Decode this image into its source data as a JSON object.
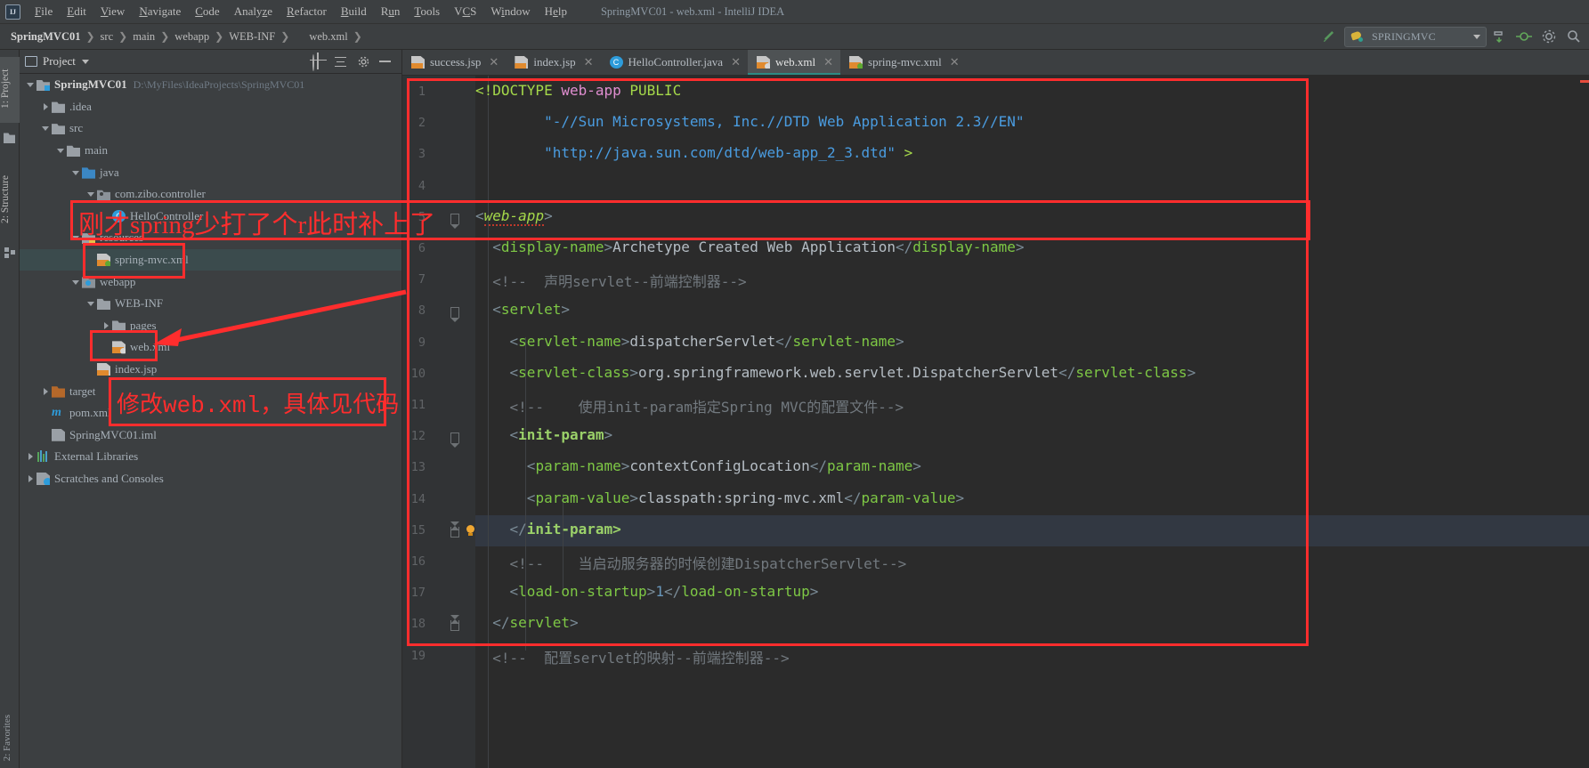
{
  "window": {
    "title": "SpringMVC01 - web.xml - IntelliJ IDEA",
    "logo": "IJ"
  },
  "menu": {
    "items": [
      "File",
      "Edit",
      "View",
      "Navigate",
      "Code",
      "Analyze",
      "Refactor",
      "Build",
      "Run",
      "Tools",
      "VCS",
      "Window",
      "Help"
    ]
  },
  "breadcrumb": {
    "items": [
      "SpringMVC01",
      "src",
      "main",
      "webapp",
      "WEB-INF",
      "web.xml"
    ],
    "separator": "❯"
  },
  "toolbar": {
    "build_icon": "hammer-icon",
    "run_config": "SPRINGMVC",
    "maven_icon": "ant-bee-icon",
    "icons": [
      "hammer-icon",
      "run-config-selector",
      "git-pull-icon",
      "git-commit-icon",
      "settings-icon",
      "search-everywhere-icon"
    ]
  },
  "left_tool_tabs": [
    {
      "label": "1: Project",
      "selected": true,
      "icon": "folder-icon"
    },
    {
      "label": "2: Structure",
      "selected": false,
      "icon": "structure-icon"
    }
  ],
  "bottom_tool_tab": "2: Favorites",
  "project_panel": {
    "title": "Project",
    "window_icon": "project-window-icon",
    "dropdown_icon": "chevron-down-icon",
    "actions": [
      "locate-target-icon",
      "collapse-all-icon",
      "settings-gear-icon",
      "hide-icon"
    ],
    "tree": [
      {
        "label": "SpringMVC01",
        "path": "D:\\MyFiles\\IdeaProjects\\SpringMVC01",
        "indent": 0,
        "arrow": "open",
        "icon": "module-folder-icon",
        "bold": true
      },
      {
        "label": ".idea",
        "indent": 1,
        "arrow": "closed",
        "icon": "folder-icon"
      },
      {
        "label": "src",
        "indent": 1,
        "arrow": "open",
        "icon": "folder-icon"
      },
      {
        "label": "main",
        "indent": 2,
        "arrow": "open",
        "icon": "folder-icon"
      },
      {
        "label": "java",
        "indent": 3,
        "arrow": "open",
        "icon": "source-folder-icon"
      },
      {
        "label": "com.zibo.controller",
        "indent": 4,
        "arrow": "open",
        "icon": "package-icon"
      },
      {
        "label": "HelloController",
        "indent": 5,
        "arrow": "none",
        "icon": "class-icon"
      },
      {
        "label": "resources",
        "indent": 3,
        "arrow": "open",
        "icon": "resources-folder-icon"
      },
      {
        "label": "spring-mvc.xml",
        "indent": 4,
        "arrow": "none",
        "icon": "spring-xml-icon",
        "selected": true
      },
      {
        "label": "webapp",
        "indent": 3,
        "arrow": "open",
        "icon": "webapp-folder-icon"
      },
      {
        "label": "WEB-INF",
        "indent": 4,
        "arrow": "open",
        "icon": "folder-icon"
      },
      {
        "label": "pages",
        "indent": 5,
        "arrow": "closed",
        "icon": "folder-icon"
      },
      {
        "label": "web.xml",
        "indent": 5,
        "arrow": "none",
        "icon": "web-xml-icon"
      },
      {
        "label": "index.jsp",
        "indent": 4,
        "arrow": "none",
        "icon": "jsp-icon"
      },
      {
        "label": "target",
        "indent": 1,
        "arrow": "closed",
        "icon": "excluded-folder-icon"
      },
      {
        "label": "pom.xml",
        "indent": 1,
        "arrow": "none",
        "icon": "maven-icon"
      },
      {
        "label": "SpringMVC01.iml",
        "indent": 1,
        "arrow": "none",
        "icon": "iml-icon"
      },
      {
        "label": "External Libraries",
        "indent": 0,
        "arrow": "closed",
        "icon": "libraries-icon"
      },
      {
        "label": "Scratches and Consoles",
        "indent": 0,
        "arrow": "closed",
        "icon": "scratches-icon"
      }
    ]
  },
  "editor_tabs": [
    {
      "label": "success.jsp",
      "icon": "jsp-icon",
      "active": false
    },
    {
      "label": "index.jsp",
      "icon": "jsp-icon",
      "active": false
    },
    {
      "label": "HelloController.java",
      "icon": "class-icon",
      "active": false
    },
    {
      "label": "web.xml",
      "icon": "web-xml-icon",
      "active": true
    },
    {
      "label": "spring-mvc.xml",
      "icon": "spring-xml-icon",
      "active": false
    }
  ],
  "editor": {
    "file": "web.xml",
    "current_line": 15,
    "line_numbers": [
      1,
      2,
      3,
      4,
      5,
      6,
      7,
      8,
      9,
      10,
      11,
      12,
      13,
      14,
      15,
      16,
      17,
      18,
      19
    ],
    "lines": [
      {
        "n": 1,
        "tokens": [
          {
            "t": "<!DOCTYPE ",
            "c": "t-kw"
          },
          {
            "t": "web-app",
            "c": "t-attr"
          },
          {
            "t": " PUBLIC",
            "c": "t-kw"
          }
        ]
      },
      {
        "n": 2,
        "tokens": [
          {
            "t": "        \"-//Sun Microsystems, Inc.//DTD Web Application 2.3//EN\"",
            "c": "t-str"
          }
        ]
      },
      {
        "n": 3,
        "tokens": [
          {
            "t": "        \"http://java.sun.com/dtd/web-app_2_3.dtd\"",
            "c": "t-str"
          },
          {
            "t": " >",
            "c": "t-kw"
          }
        ]
      },
      {
        "n": 4,
        "tokens": []
      },
      {
        "n": 5,
        "tokens": [
          {
            "t": "<",
            "c": "t-br"
          },
          {
            "t": "web-app",
            "c": "t-webapp squig"
          },
          {
            "t": ">",
            "c": "t-br"
          }
        ]
      },
      {
        "n": 6,
        "tokens": [
          {
            "t": "  <",
            "c": "t-br"
          },
          {
            "t": "display-name",
            "c": "t-tag"
          },
          {
            "t": ">",
            "c": "t-br"
          },
          {
            "t": "Archetype Created Web Application",
            "c": "t-txt"
          },
          {
            "t": "</",
            "c": "t-br"
          },
          {
            "t": "display-name",
            "c": "t-tag"
          },
          {
            "t": ">",
            "c": "t-br"
          }
        ]
      },
      {
        "n": 7,
        "tokens": [
          {
            "t": "  <!--  声明servlet--前端控制器-->",
            "c": "t-com"
          }
        ]
      },
      {
        "n": 8,
        "tokens": [
          {
            "t": "  <",
            "c": "t-br"
          },
          {
            "t": "servlet",
            "c": "t-tag"
          },
          {
            "t": ">",
            "c": "t-br"
          }
        ]
      },
      {
        "n": 9,
        "tokens": [
          {
            "t": "    <",
            "c": "t-br"
          },
          {
            "t": "servlet-name",
            "c": "t-tag"
          },
          {
            "t": ">",
            "c": "t-br"
          },
          {
            "t": "dispatcherServlet",
            "c": "t-txt"
          },
          {
            "t": "</",
            "c": "t-br"
          },
          {
            "t": "servlet-name",
            "c": "t-tag"
          },
          {
            "t": ">",
            "c": "t-br"
          }
        ]
      },
      {
        "n": 10,
        "tokens": [
          {
            "t": "    <",
            "c": "t-br"
          },
          {
            "t": "servlet-class",
            "c": "t-tag"
          },
          {
            "t": ">",
            "c": "t-br"
          },
          {
            "t": "org.springframework.web.servlet.DispatcherServlet",
            "c": "t-txt"
          },
          {
            "t": "</",
            "c": "t-br"
          },
          {
            "t": "servlet-class",
            "c": "t-tag"
          },
          {
            "t": ">",
            "c": "t-br"
          }
        ]
      },
      {
        "n": 11,
        "tokens": [
          {
            "t": "    <!--    使用init-param指定Spring MVC的配置文件-->",
            "c": "t-com"
          }
        ]
      },
      {
        "n": 12,
        "tokens": [
          {
            "t": "    <",
            "c": "t-br"
          },
          {
            "t": "init-param",
            "c": "t-tagb"
          },
          {
            "t": ">",
            "c": "t-br"
          }
        ]
      },
      {
        "n": 13,
        "tokens": [
          {
            "t": "      <",
            "c": "t-br"
          },
          {
            "t": "param-name",
            "c": "t-tag"
          },
          {
            "t": ">",
            "c": "t-br"
          },
          {
            "t": "contextConfigLocation",
            "c": "t-txt"
          },
          {
            "t": "</",
            "c": "t-br"
          },
          {
            "t": "param-name",
            "c": "t-tag"
          },
          {
            "t": ">",
            "c": "t-br"
          }
        ]
      },
      {
        "n": 14,
        "tokens": [
          {
            "t": "      <",
            "c": "t-br"
          },
          {
            "t": "param-value",
            "c": "t-tag"
          },
          {
            "t": ">",
            "c": "t-br"
          },
          {
            "t": "classpath:spring-mvc.xml",
            "c": "t-txt"
          },
          {
            "t": "</",
            "c": "t-br"
          },
          {
            "t": "param-value",
            "c": "t-tag"
          },
          {
            "t": ">",
            "c": "t-br"
          }
        ]
      },
      {
        "n": 15,
        "tokens": [
          {
            "t": "    </",
            "c": "t-br"
          },
          {
            "t": "init-param",
            "c": "t-tagb"
          },
          {
            "t": ">",
            "c": "t-tagb"
          }
        ]
      },
      {
        "n": 16,
        "tokens": [
          {
            "t": "    <!--    当启动服务器的时候创建DispatcherServlet-->",
            "c": "t-com"
          }
        ]
      },
      {
        "n": 17,
        "tokens": [
          {
            "t": "    <",
            "c": "t-br"
          },
          {
            "t": "load-on-startup",
            "c": "t-tag"
          },
          {
            "t": ">",
            "c": "t-br"
          },
          {
            "t": "1",
            "c": "t-num"
          },
          {
            "t": "</",
            "c": "t-br"
          },
          {
            "t": "load-on-startup",
            "c": "t-tag"
          },
          {
            "t": ">",
            "c": "t-br"
          }
        ]
      },
      {
        "n": 18,
        "tokens": [
          {
            "t": "  </",
            "c": "t-br"
          },
          {
            "t": "servlet",
            "c": "t-tag"
          },
          {
            "t": ">",
            "c": "t-br"
          }
        ]
      },
      {
        "n": 19,
        "tokens": [
          {
            "t": "  <!--  配置servlet的映射--前端控制器-->",
            "c": "t-com"
          }
        ]
      }
    ]
  },
  "annotations": [
    {
      "id": "note-spring-typo",
      "text": "刚才spring少打了个r此时补上了"
    },
    {
      "id": "note-modify-webxml",
      "text": "修改web.xml，具体见代码"
    }
  ]
}
